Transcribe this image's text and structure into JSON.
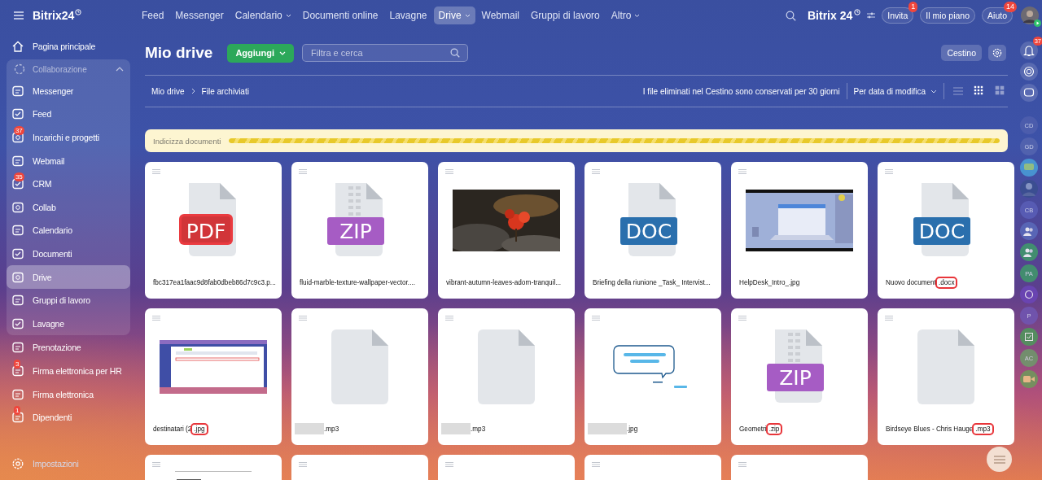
{
  "header": {
    "logo": "Bitrix24",
    "nav": [
      {
        "label": "Feed",
        "selected": false,
        "dropdown": false
      },
      {
        "label": "Messenger",
        "selected": false,
        "dropdown": false
      },
      {
        "label": "Calendario",
        "selected": false,
        "dropdown": true
      },
      {
        "label": "Documenti online",
        "selected": false,
        "dropdown": false
      },
      {
        "label": "Lavagne",
        "selected": false,
        "dropdown": false
      },
      {
        "label": "Drive",
        "selected": true,
        "dropdown": true
      },
      {
        "label": "Webmail",
        "selected": false,
        "dropdown": false
      },
      {
        "label": "Gruppi di lavoro",
        "selected": false,
        "dropdown": false
      },
      {
        "label": "Altro",
        "selected": false,
        "dropdown": true
      }
    ],
    "brand": "Bitrix 24",
    "buttons": [
      {
        "label": "Invita",
        "badge": "1"
      },
      {
        "label": "Il mio piano"
      },
      {
        "label": "Aiuto",
        "badge": "14"
      }
    ]
  },
  "sidebar": {
    "items": [
      {
        "label": "Pagina principale",
        "selected": false
      },
      {
        "label": "Collaborazione",
        "kind": "group",
        "expanded": true,
        "children": [
          {
            "label": "Messenger",
            "selected": false
          },
          {
            "label": "Feed",
            "selected": false
          },
          {
            "label": "Incarichi e progetti",
            "selected": false,
            "badge": "37"
          },
          {
            "label": "Webmail",
            "selected": false
          },
          {
            "label": "CRM",
            "selected": false,
            "badge": "35"
          },
          {
            "label": "Collab",
            "selected": false
          },
          {
            "label": "Calendario",
            "selected": false
          },
          {
            "label": "Documenti",
            "selected": false
          },
          {
            "label": "Drive",
            "selected": true
          },
          {
            "label": "Gruppi di lavoro",
            "selected": false
          },
          {
            "label": "Lavagne",
            "selected": false
          }
        ]
      },
      {
        "label": "Prenotazione",
        "selected": false
      },
      {
        "label": "Firma elettronica per HR",
        "selected": false,
        "badge": "3"
      },
      {
        "label": "Firma elettronica",
        "selected": false
      },
      {
        "label": "Dipendenti",
        "selected": false,
        "badge": "1"
      }
    ],
    "settings": "Impostazioni"
  },
  "toolbar": {
    "title": "Mio drive",
    "add_button": "Aggiungi",
    "search": {
      "placeholder": "Filtra e cerca"
    },
    "trash_button": "Cestino"
  },
  "breadcrumb": [
    "Mio drive",
    "File archiviati"
  ],
  "info": "I file eliminati nel Cestino sono conservati per 30 giorni",
  "sort": "Per data di modifica",
  "views": [
    {
      "selected": false
    },
    {
      "selected": true
    },
    {
      "selected": false
    }
  ],
  "indexing": {
    "label": "Indicizza documenti",
    "level": 1
  },
  "files": [
    {
      "kind": "pdf",
      "label": "PDF",
      "name": "fbc317ea1faac9d8fab0dbeb86d7c9c3.p..."
    },
    {
      "kind": "zip",
      "label": "ZIP",
      "name": "fluid-marble-texture-wallpaper-vector...."
    },
    {
      "kind": "picture",
      "name": "vibrant-autumn-leaves-adorn-tranquil..."
    },
    {
      "kind": "doc",
      "label": "DOC",
      "name": "Briefing della riunione _Task_ Intervist..."
    },
    {
      "kind": "picture",
      "name": "HelpDesk_Intro_.jpg"
    },
    {
      "kind": "doc",
      "label": "DOC",
      "name": "Nuovo document",
      "ext": ".docx",
      "marked": true
    },
    {
      "kind": "picture",
      "name": "destinatari (2",
      "ext": ".jpg",
      "marked": true
    },
    {
      "kind": "blank",
      "ext": ".mp3",
      "marked": false,
      "redacted": true
    },
    {
      "kind": "blank",
      "ext": ".mp3",
      "marked": false,
      "redacted": true
    },
    {
      "kind": "picture",
      "ext": ".jpg",
      "marked": false,
      "redacted": true
    },
    {
      "kind": "zip",
      "label": "ZIP",
      "name": "Geometri",
      "ext": ".zip",
      "marked": true
    },
    {
      "kind": "blank",
      "name": "Birdseye Blues - Chris Hauge",
      "ext": ".mp3",
      "marked": true
    },
    {
      "kind": "picture"
    },
    {
      "kind": "blank"
    },
    {
      "kind": "blank"
    },
    {
      "kind": "blank"
    },
    {
      "kind": "blank"
    }
  ],
  "right_rail": {
    "bell_badge": "37",
    "avatars": [
      "CD",
      "GD",
      "CB",
      "PA",
      "P",
      "AC"
    ]
  }
}
